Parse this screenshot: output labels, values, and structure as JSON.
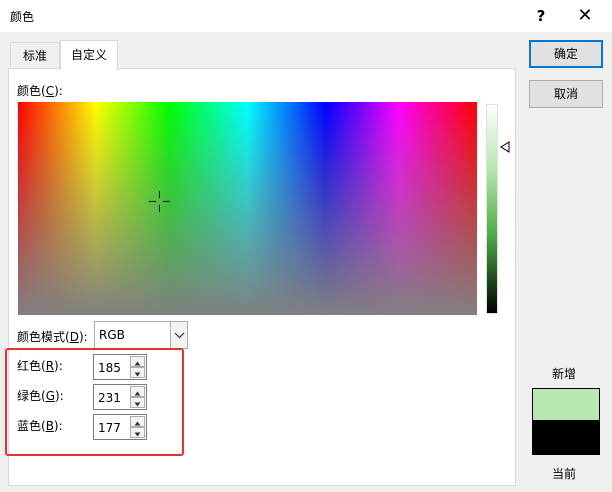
{
  "window": {
    "title": "颜色",
    "help_glyph": "?",
    "close_glyph": "✕"
  },
  "tabs": [
    {
      "label": "标准"
    },
    {
      "label": "自定义"
    }
  ],
  "color_picker": {
    "label_prefix": "颜色(",
    "label_key": "C",
    "label_suffix": "):",
    "luminance_arrow": "triangle-left-icon"
  },
  "color_model": {
    "label_prefix": "颜色模式(",
    "label_key": "D",
    "label_suffix": "):",
    "value": "RGB"
  },
  "fields": {
    "red": {
      "label_prefix": "红色(",
      "label_key": "R",
      "label_suffix": "):",
      "value": "185"
    },
    "green": {
      "label_prefix": "绿色(",
      "label_key": "G",
      "label_suffix": "):",
      "value": "231"
    },
    "blue": {
      "label_prefix": "蓝色(",
      "label_key": "B",
      "label_suffix": "):",
      "value": "177"
    }
  },
  "buttons": {
    "ok": "确定",
    "cancel": "取消"
  },
  "preview": {
    "new_label": "新增",
    "current_label": "当前",
    "new_color": "#b9e7b1",
    "current_color": "#000000"
  },
  "colors": {
    "highlight": "#e8322c",
    "accent": "#0078d7"
  }
}
